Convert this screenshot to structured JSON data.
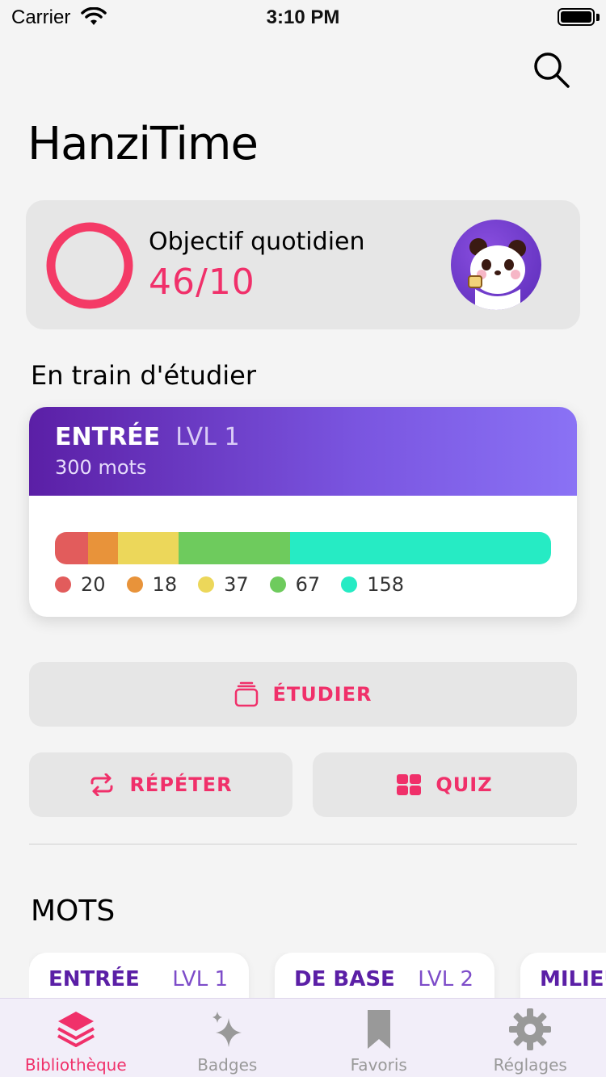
{
  "status_bar": {
    "carrier": "Carrier",
    "time": "3:10 PM"
  },
  "app": {
    "title": "HanziTime"
  },
  "goal": {
    "label": "Objectif quotidien",
    "value": "46/10",
    "progress": 1.0
  },
  "studying": {
    "section_title": "En train d'étudier",
    "level_name": "ENTRÉE",
    "level_lvl": "LVL 1",
    "word_count": "300 mots",
    "segments": [
      {
        "value": "20",
        "color": "#e25c5c"
      },
      {
        "value": "18",
        "color": "#e8933a"
      },
      {
        "value": "37",
        "color": "#ecd75a"
      },
      {
        "value": "67",
        "color": "#6ecb5d"
      },
      {
        "value": "158",
        "color": "#26ebc4"
      }
    ]
  },
  "actions": {
    "study": "ÉTUDIER",
    "repeat": "RÉPÉTER",
    "quiz": "QUIZ"
  },
  "words": {
    "title": "MOTS",
    "cards": [
      {
        "name": "ENTRÉE",
        "lvl": "LVL 1"
      },
      {
        "name": "DE BASE",
        "lvl": "LVL 2"
      },
      {
        "name": "MILIEU",
        "lvl": ""
      }
    ]
  },
  "tabs": [
    {
      "label": "Bibliothèque",
      "icon": "stack-icon",
      "active": true
    },
    {
      "label": "Badges",
      "icon": "sparkles-icon",
      "active": false
    },
    {
      "label": "Favoris",
      "icon": "bookmark-icon",
      "active": false
    },
    {
      "label": "Réglages",
      "icon": "gear-icon",
      "active": false
    }
  ],
  "colors": {
    "accent": "#f0306a",
    "purple": "#5b1fa6"
  }
}
